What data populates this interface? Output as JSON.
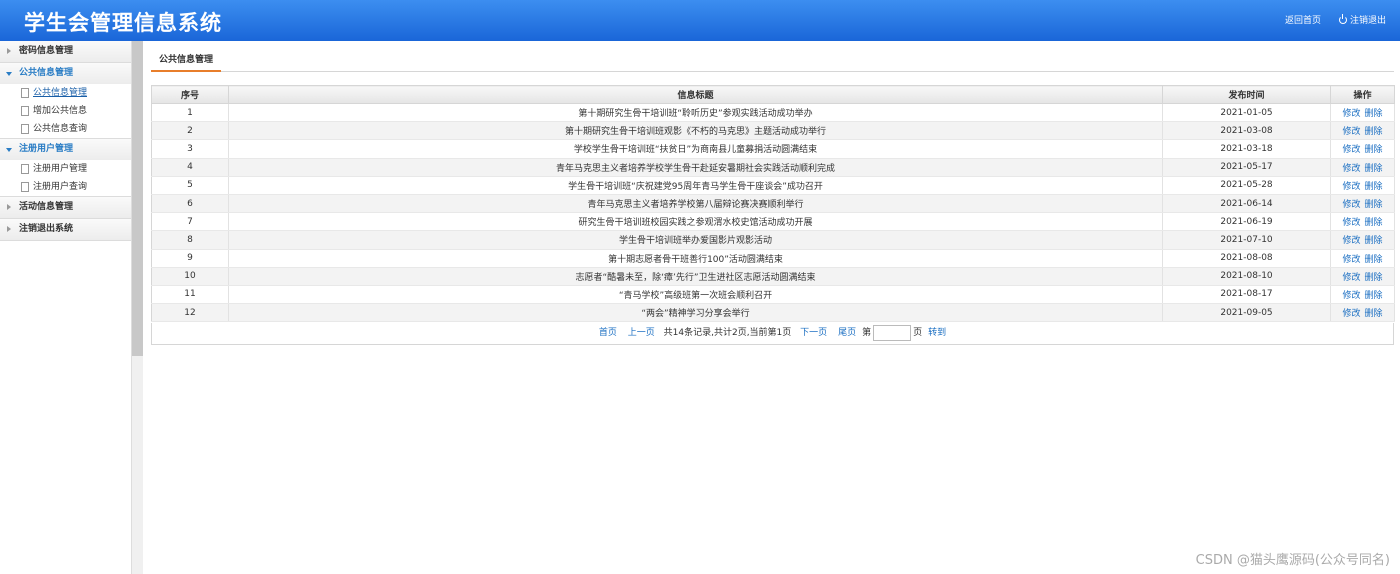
{
  "header": {
    "title": "学生会管理信息系统",
    "home_link": "返回首页",
    "logout_link": "注销退出"
  },
  "sidebar": {
    "groups": [
      {
        "label": "密码信息管理",
        "open": false,
        "items": []
      },
      {
        "label": "公共信息管理",
        "open": true,
        "items": [
          "公共信息管理",
          "增加公共信息",
          "公共信息查询"
        ]
      },
      {
        "label": "注册用户管理",
        "open": true,
        "items": [
          "注册用户管理",
          "注册用户查询"
        ]
      },
      {
        "label": "活动信息管理",
        "open": false,
        "items": []
      },
      {
        "label": "注销退出系统",
        "open": false,
        "items": []
      }
    ]
  },
  "tab": {
    "label": "公共信息管理"
  },
  "table": {
    "columns": [
      "序号",
      "信息标题",
      "发布时间",
      "操作"
    ],
    "edit_label": "修改",
    "delete_label": "删除",
    "rows": [
      {
        "no": "1",
        "title": "第十期研究生骨干培训班“聆听历史”参观实践活动成功举办",
        "date": "2021-01-05"
      },
      {
        "no": "2",
        "title": "第十期研究生骨干培训班观影《不朽的马克思》主题活动成功举行",
        "date": "2021-03-08"
      },
      {
        "no": "3",
        "title": "学校学生骨干培训班“扶贫日”为商南县儿童募捐活动圆满结束",
        "date": "2021-03-18"
      },
      {
        "no": "4",
        "title": "青年马克思主义者培养学校学生骨干赴延安暑期社会实践活动顺利完成",
        "date": "2021-05-17"
      },
      {
        "no": "5",
        "title": "学生骨干培训班“庆祝建党95周年青马学生骨干座谈会”成功召开",
        "date": "2021-05-28"
      },
      {
        "no": "6",
        "title": "青年马克思主义者培养学校第八届辩论赛决赛顺利举行",
        "date": "2021-06-14"
      },
      {
        "no": "7",
        "title": "研究生骨干培训班校园实践之参观渭水校史馆活动成功开展",
        "date": "2021-06-19"
      },
      {
        "no": "8",
        "title": "学生骨干培训班举办爱国影片观影活动",
        "date": "2021-07-10"
      },
      {
        "no": "9",
        "title": "第十期志愿者骨干班善行100”活动圆满结束",
        "date": "2021-08-08"
      },
      {
        "no": "10",
        "title": "志愿者“酷暑未至，除‘瘴’先行”卫生进社区志愿活动圆满结束",
        "date": "2021-08-10"
      },
      {
        "no": "11",
        "title": "“青马学校”高级班第一次班会顺利召开",
        "date": "2021-08-17"
      },
      {
        "no": "12",
        "title": "“两会”精神学习分享会举行",
        "date": "2021-09-05"
      }
    ]
  },
  "pager": {
    "first": "首页",
    "prev": "上一页",
    "summary": "共14条记录,共计2页,当前第1页",
    "next": "下一页",
    "last": "尾页",
    "page_prefix": "第",
    "page_suffix": "页",
    "go": "转到",
    "page_input_value": ""
  },
  "watermark": "CSDN @猫头鹰源码(公众号同名)"
}
